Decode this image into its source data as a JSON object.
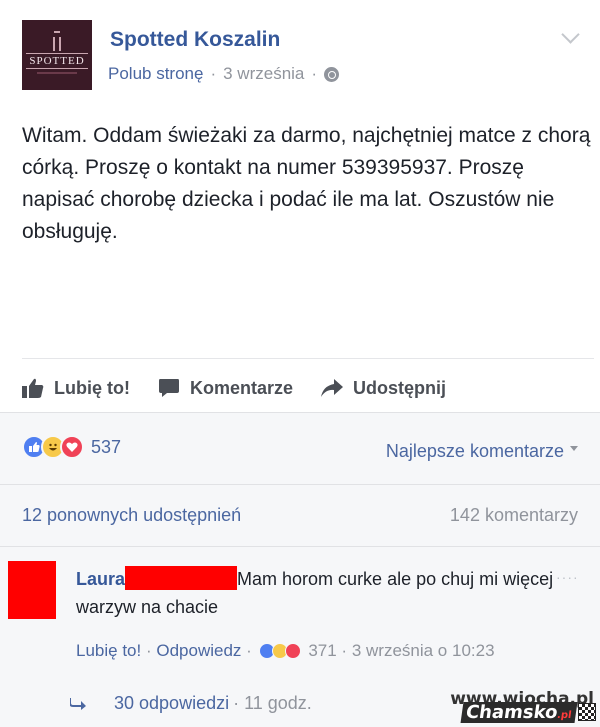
{
  "post": {
    "page_name": "Spotted Koszalin",
    "avatar_text": "SPOTTED",
    "like_page": "Polub stronę",
    "separator": "·",
    "date": "3 września",
    "text": "Witam. Oddam świeżaki za darmo, najchętniej matce z chorą córką. Proszę o kontakt na numer 539395937. Proszę napisać chorobę dziecka i podać ile ma lat. Oszustów nie obsługuję."
  },
  "actions": {
    "like": "Lubię to!",
    "comment": "Komentarze",
    "share": "Udostępnij"
  },
  "stats": {
    "reaction_count": "537",
    "sort_label": "Najlepsze komentarze",
    "shares": "12 ponownych udostępnień",
    "comments": "142 komentarzy"
  },
  "comment": {
    "author": "Laura",
    "text": "Mam horom curke ale po chuj mi więcej warzyw na chacie",
    "like": "Lubię to!",
    "reply": "Odpowiedz",
    "separator": "·",
    "reaction_count": "371",
    "time": "3 września o 10:23",
    "menu": "····",
    "replies": "30 odpowiedzi",
    "replies_time": "· 11 godz."
  },
  "watermark": {
    "back_text": "www.wiocha.pl",
    "main_text": "Chamsko",
    "tld": ".pl"
  },
  "colors": {
    "link": "#365899",
    "meta": "#90949c",
    "like_reaction": "#4f7ff1",
    "haha_reaction": "#f7c94a",
    "love_reaction": "#f04257",
    "redaction": "#ff0000"
  },
  "icons": [
    "chevron-down-icon",
    "globe-icon",
    "thumbs-up-icon",
    "comment-bubble-icon",
    "share-arrow-icon",
    "reply-arrow-icon",
    "more-dots-icon"
  ]
}
